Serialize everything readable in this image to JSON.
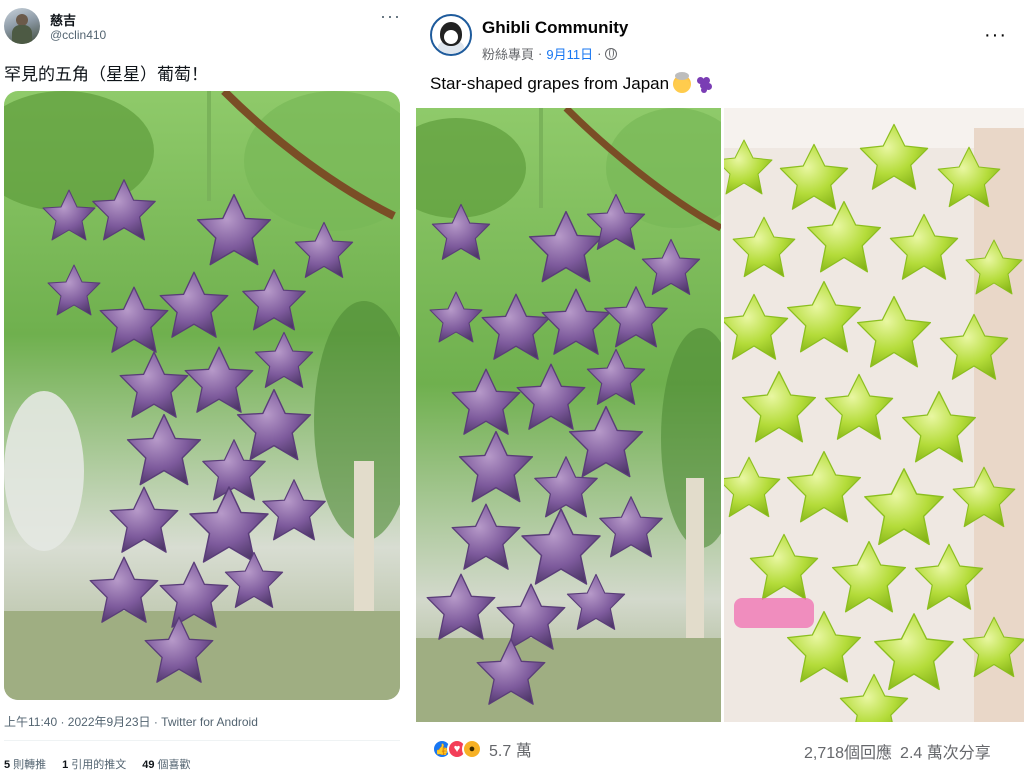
{
  "twitter": {
    "display_name": "慈吉",
    "handle": "@cclin410",
    "more_label": "···",
    "tweet_text": "罕見的五角（星星）葡萄！",
    "photo_alt": "Purple star-shaped grapes on the vine",
    "timestamp": "上午11:40 · 2022年9月23日 · Twitter for Android",
    "stats": [
      {
        "count": "5",
        "label": "則轉推"
      },
      {
        "count": "1",
        "label": "引用的推文"
      },
      {
        "count": "49",
        "label": "個喜歡"
      }
    ]
  },
  "facebook": {
    "page_name": "Ghibli Community",
    "page_type": "粉絲專頁",
    "date": "9月11日",
    "more_label": "···",
    "post_text": "Star-shaped grapes from Japan",
    "reaction_icons": [
      "like-icon",
      "love-icon",
      "wow-icon"
    ],
    "reaction_count": "5.7 萬",
    "comments": "2,718個回應",
    "shares": "2.4 萬次分享",
    "colors": {
      "link": "#1877f2",
      "like": "#1877f2",
      "love": "#f33e58",
      "wow": "#f7b125"
    }
  }
}
